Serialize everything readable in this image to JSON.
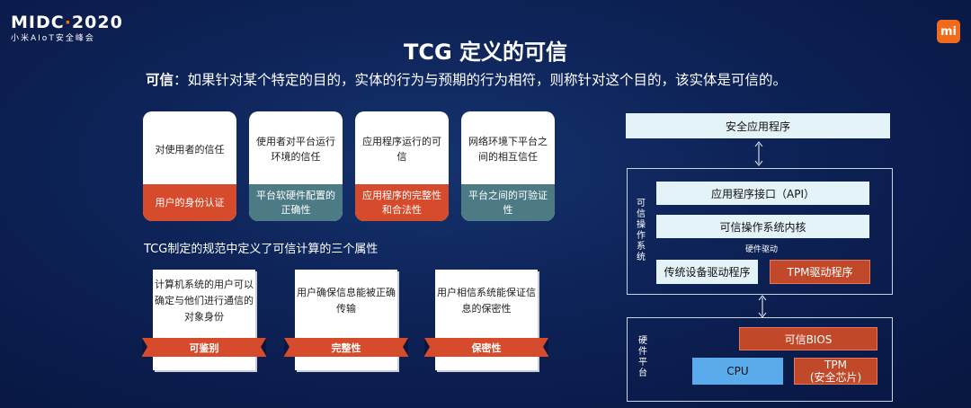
{
  "brand": {
    "logo_main_a": "MIDC",
    "logo_dot": "·",
    "logo_main_b": "2020",
    "logo_sub": "小米AIoT安全峰会",
    "mi": "mi"
  },
  "title": "TCG 定义的可信",
  "subtitle": {
    "lead": "可信",
    "text": "：如果针对某个特定的目的，实体的行为与预期的行为相符，则称针对这个目的，该实体是可信的。"
  },
  "cards": [
    {
      "top": "对使用者的信任",
      "bottom": "用户的身份认证",
      "color": "#d64b2c"
    },
    {
      "top": "使用者对平台运行环境的信任",
      "bottom": "平台软硬件配置的正确性",
      "color": "#4d7b85"
    },
    {
      "top": "应用程序运行的可信",
      "bottom": "应用程序的完整性和合法性",
      "color": "#d64b2c"
    },
    {
      "top": "网络环境下平台之间的相互信任",
      "bottom": "平台之间的可验证性",
      "color": "#4d7b85"
    }
  ],
  "mid_label": "TCG制定的规范中定义了可信计算的三个属性",
  "properties": [
    {
      "text": "计算机系统的用户可以确定与他们进行通信的对象身份",
      "tag": "可鉴别"
    },
    {
      "text": "用户确保信息能被正确传输",
      "tag": "完整性"
    },
    {
      "text": "用户相信系统能保证信息的保密性",
      "tag": "保密性"
    }
  ],
  "arch": {
    "app": "安全应用程序",
    "os_label": "可信操作系统",
    "api": "应用程序接口（API）",
    "kernel": "可信操作系统内核",
    "driver_label": "硬件驱动",
    "legacy_driver": "传统设备驱动程序",
    "tpm_driver": "TPM驱动程序",
    "hw_label": "硬件平台",
    "bios": "可信BIOS",
    "cpu": "CPU",
    "tpm_line1": "TPM",
    "tpm_line2": "(安全芯片)"
  },
  "colors": {
    "accent_red": "#d64b2c",
    "accent_teal": "#4d7b85",
    "box_light": "#e3f3f8",
    "cpu_blue": "#5aabec",
    "mi_orange": "#f26b1d"
  }
}
